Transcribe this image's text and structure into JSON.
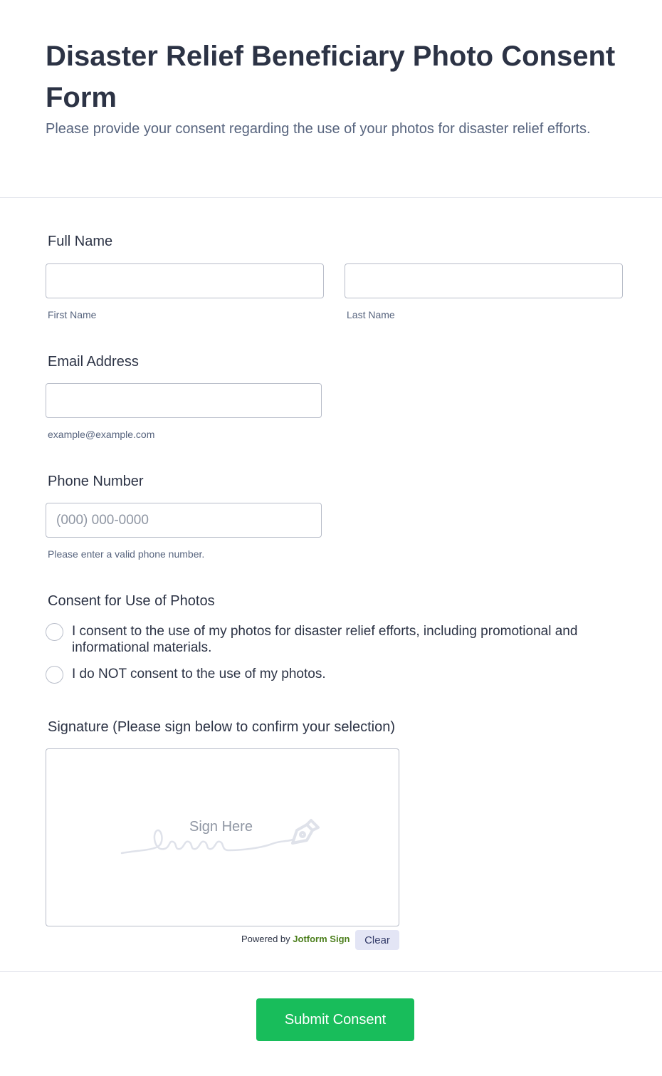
{
  "header": {
    "title": "Disaster Relief Beneficiary Photo Consent Form",
    "subtitle": "Please provide your consent regarding the use of your photos for disaster relief efforts."
  },
  "full_name": {
    "label": "Full Name",
    "first_sublabel": "First Name",
    "last_sublabel": "Last Name",
    "first_value": "",
    "last_value": ""
  },
  "email": {
    "label": "Email Address",
    "value": "",
    "sublabel": "example@example.com"
  },
  "phone": {
    "label": "Phone Number",
    "placeholder": "(000) 000-0000",
    "value": "",
    "sublabel": "Please enter a valid phone number."
  },
  "consent": {
    "label": "Consent for Use of Photos",
    "options": [
      "I consent to the use of my photos for disaster relief efforts, including promotional and informational materials.",
      "I do NOT consent to the use of my photos."
    ]
  },
  "signature": {
    "label": "Signature (Please sign below to confirm your selection)",
    "placeholder": "Sign Here",
    "powered_by": "Powered by",
    "brand": "Jotform Sign",
    "clear_label": "Clear"
  },
  "submit": {
    "label": "Submit Consent"
  },
  "colors": {
    "submit_bg": "#18bd5b",
    "brand_green": "#4c7f1c",
    "text": "#2c3345"
  },
  "icons": [
    "pen-nib-icon",
    "signature-scribble-icon"
  ]
}
